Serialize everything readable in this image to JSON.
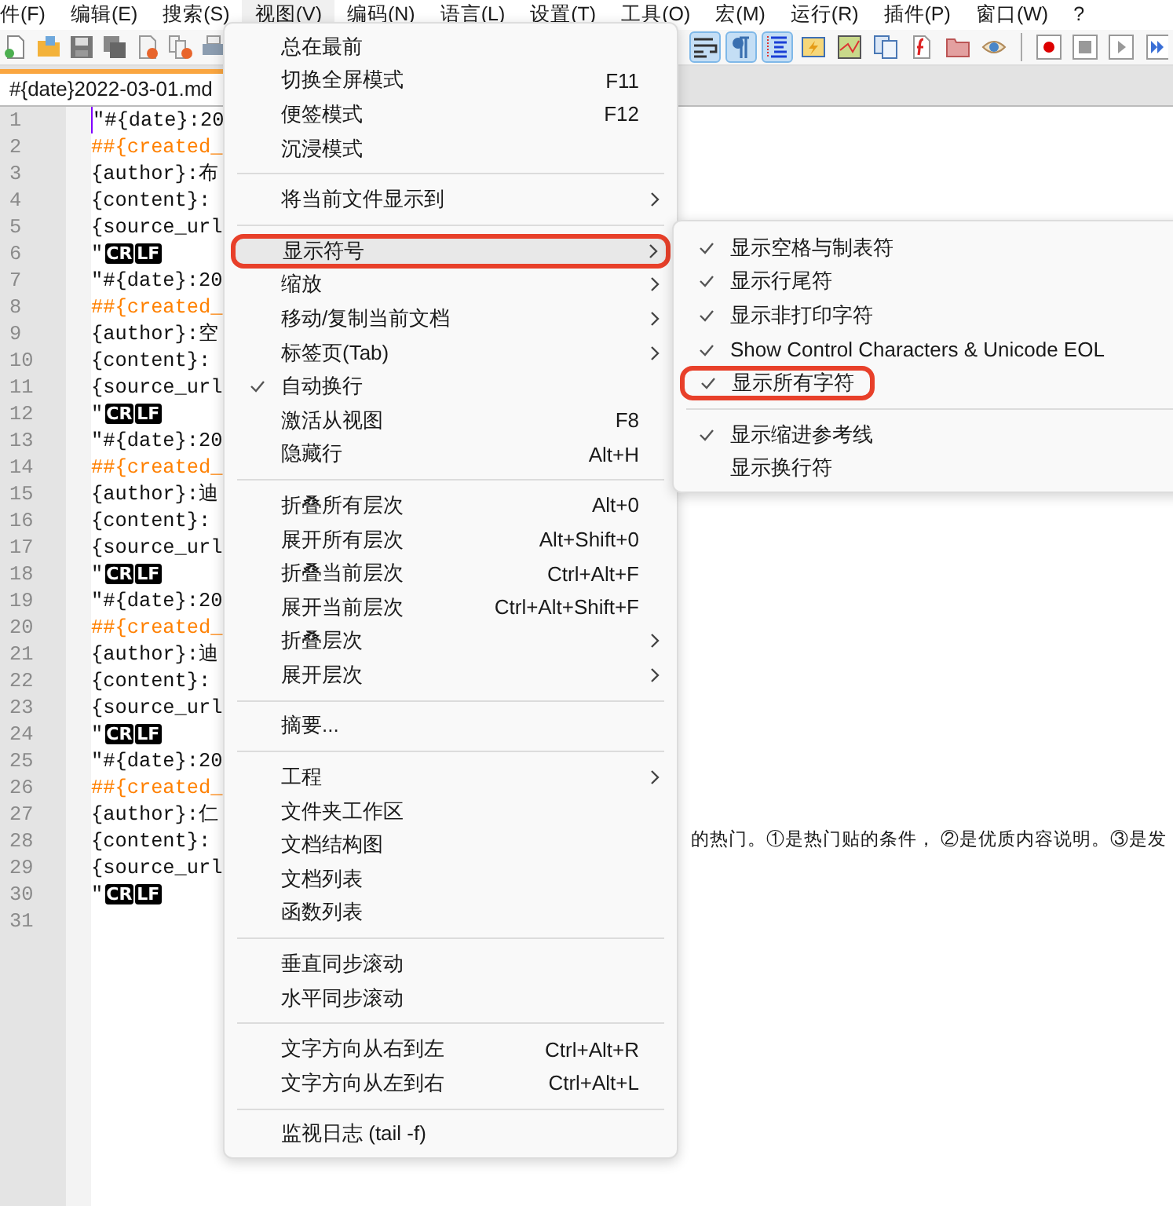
{
  "menubar": [
    {
      "label": "件(F)",
      "selected": false
    },
    {
      "label": "编辑(E)",
      "selected": false
    },
    {
      "label": "搜索(S)",
      "selected": false
    },
    {
      "label": "视图(V)",
      "selected": true
    },
    {
      "label": "编码(N)",
      "selected": false
    },
    {
      "label": "语言(L)",
      "selected": false
    },
    {
      "label": "设置(T)",
      "selected": false
    },
    {
      "label": "工具(O)",
      "selected": false
    },
    {
      "label": "宏(M)",
      "selected": false
    },
    {
      "label": "运行(R)",
      "selected": false
    },
    {
      "label": "插件(P)",
      "selected": false
    },
    {
      "label": "窗口(W)",
      "selected": false
    },
    {
      "label": "?",
      "selected": false
    }
  ],
  "toolbar_left": [
    {
      "kind": "new",
      "on": false
    },
    {
      "kind": "open",
      "on": false
    },
    {
      "kind": "save",
      "on": false
    },
    {
      "kind": "save-all",
      "on": false
    },
    {
      "kind": "close",
      "on": false
    },
    {
      "kind": "close-all",
      "on": false
    },
    {
      "kind": "print",
      "on": false
    }
  ],
  "toolbar_right": [
    {
      "kind": "wrap",
      "on": true
    },
    {
      "kind": "pilcrow",
      "on": true
    },
    {
      "kind": "indent-guide",
      "on": true
    },
    {
      "kind": "lightning",
      "on": false
    },
    {
      "kind": "map",
      "on": false
    },
    {
      "kind": "documents",
      "on": false
    },
    {
      "kind": "function",
      "on": false
    },
    {
      "kind": "folder",
      "on": false
    },
    {
      "kind": "eye",
      "on": false
    },
    {
      "kind": "separator"
    },
    {
      "kind": "record",
      "on": false
    },
    {
      "kind": "stop",
      "on": false
    },
    {
      "kind": "play",
      "on": false
    },
    {
      "kind": "fast-forward",
      "on": false
    }
  ],
  "tab": {
    "label": "#{date}2022-03-01.md"
  },
  "lines": [
    {
      "number": "1",
      "kind": "text",
      "text": "\"#{date}:20"
    },
    {
      "number": "2",
      "kind": "heading",
      "text": "##{created_"
    },
    {
      "number": "3",
      "kind": "text",
      "text": "{author}:布"
    },
    {
      "number": "4",
      "kind": "text",
      "text": "{content}:"
    },
    {
      "number": "5",
      "kind": "text",
      "text": "{source_url"
    },
    {
      "number": "6",
      "kind": "eol",
      "text": "\"",
      "cr": "CR",
      "lf": "LF"
    },
    {
      "number": "7",
      "kind": "text",
      "text": "\"#{date}:20"
    },
    {
      "number": "8",
      "kind": "heading",
      "text": "##{created_"
    },
    {
      "number": "9",
      "kind": "text",
      "text": "{author}:空"
    },
    {
      "number": "10",
      "kind": "text",
      "text": "{content}:"
    },
    {
      "number": "11",
      "kind": "text",
      "text": "{source_url"
    },
    {
      "number": "12",
      "kind": "eol",
      "text": "\"",
      "cr": "CR",
      "lf": "LF"
    },
    {
      "number": "13",
      "kind": "text",
      "text": "\"#{date}:20"
    },
    {
      "number": "14",
      "kind": "heading",
      "text": "##{created_"
    },
    {
      "number": "15",
      "kind": "text",
      "text": "{author}:迪"
    },
    {
      "number": "16",
      "kind": "text",
      "text": "{content}:"
    },
    {
      "number": "17",
      "kind": "text",
      "text": "{source_url"
    },
    {
      "number": "18",
      "kind": "eol",
      "text": "\"",
      "cr": "CR",
      "lf": "LF"
    },
    {
      "number": "19",
      "kind": "text",
      "text": "\"#{date}:20"
    },
    {
      "number": "20",
      "kind": "heading",
      "text": "##{created_"
    },
    {
      "number": "21",
      "kind": "text",
      "text": "{author}:迪"
    },
    {
      "number": "22",
      "kind": "text",
      "text": "{content}:"
    },
    {
      "number": "23",
      "kind": "text",
      "text": "{source_url"
    },
    {
      "number": "24",
      "kind": "eol",
      "text": "\"",
      "cr": "CR",
      "lf": "LF"
    },
    {
      "number": "25",
      "kind": "text",
      "text": "\"#{date}:20"
    },
    {
      "number": "26",
      "kind": "heading",
      "text": "##{created_"
    },
    {
      "number": "27",
      "kind": "text",
      "text": "{author}:仁"
    },
    {
      "number": "28",
      "kind": "text",
      "text": "{content}:",
      "tail": "的热门。①是热门贴的条件， ②是优质内容说明。③是发"
    },
    {
      "number": "29",
      "kind": "text",
      "text": "{source_url"
    },
    {
      "number": "30",
      "kind": "eol",
      "text": "\"",
      "cr": "CR",
      "lf": "LF"
    },
    {
      "number": "31",
      "kind": "empty"
    }
  ],
  "view_menu": [
    {
      "kind": "item",
      "label": "总在最前",
      "checked": false,
      "selected": false,
      "submenu": false,
      "highlighted": false
    },
    {
      "kind": "item",
      "label": "切换全屏模式",
      "shortcut": "F11",
      "checked": false,
      "selected": false,
      "submenu": false,
      "highlighted": false
    },
    {
      "kind": "item",
      "label": "便签模式",
      "shortcut": "F12",
      "checked": false,
      "selected": false,
      "submenu": false,
      "highlighted": false
    },
    {
      "kind": "item",
      "label": "沉浸模式",
      "checked": false,
      "selected": false,
      "submenu": false,
      "highlighted": false
    },
    {
      "kind": "separator"
    },
    {
      "kind": "item",
      "label": "将当前文件显示到",
      "checked": false,
      "selected": false,
      "submenu": true,
      "highlighted": false
    },
    {
      "kind": "separator"
    },
    {
      "kind": "item",
      "label": "显示符号",
      "checked": false,
      "selected": true,
      "submenu": true,
      "highlighted": true
    },
    {
      "kind": "item",
      "label": "缩放",
      "checked": false,
      "selected": false,
      "submenu": true,
      "highlighted": false
    },
    {
      "kind": "item",
      "label": "移动/复制当前文档",
      "checked": false,
      "selected": false,
      "submenu": true,
      "highlighted": false
    },
    {
      "kind": "item",
      "label": "标签页(Tab)",
      "checked": false,
      "selected": false,
      "submenu": true,
      "highlighted": false
    },
    {
      "kind": "item",
      "label": "自动换行",
      "checked": true,
      "selected": false,
      "submenu": false,
      "highlighted": false
    },
    {
      "kind": "item",
      "label": "激活从视图",
      "shortcut": "F8",
      "checked": false,
      "selected": false,
      "submenu": false,
      "highlighted": false
    },
    {
      "kind": "item",
      "label": "隐藏行",
      "shortcut": "Alt+H",
      "checked": false,
      "selected": false,
      "submenu": false,
      "highlighted": false
    },
    {
      "kind": "separator"
    },
    {
      "kind": "item",
      "label": "折叠所有层次",
      "shortcut": "Alt+0",
      "checked": false,
      "selected": false,
      "submenu": false,
      "highlighted": false
    },
    {
      "kind": "item",
      "label": "展开所有层次",
      "shortcut": "Alt+Shift+0",
      "checked": false,
      "selected": false,
      "submenu": false,
      "highlighted": false
    },
    {
      "kind": "item",
      "label": "折叠当前层次",
      "shortcut": "Ctrl+Alt+F",
      "checked": false,
      "selected": false,
      "submenu": false,
      "highlighted": false
    },
    {
      "kind": "item",
      "label": "展开当前层次",
      "shortcut": "Ctrl+Alt+Shift+F",
      "checked": false,
      "selected": false,
      "submenu": false,
      "highlighted": false
    },
    {
      "kind": "item",
      "label": "折叠层次",
      "checked": false,
      "selected": false,
      "submenu": true,
      "highlighted": false
    },
    {
      "kind": "item",
      "label": "展开层次",
      "checked": false,
      "selected": false,
      "submenu": true,
      "highlighted": false
    },
    {
      "kind": "separator"
    },
    {
      "kind": "item",
      "label": "摘要...",
      "checked": false,
      "selected": false,
      "submenu": false,
      "highlighted": false
    },
    {
      "kind": "separator"
    },
    {
      "kind": "item",
      "label": "工程",
      "checked": false,
      "selected": false,
      "submenu": true,
      "highlighted": false
    },
    {
      "kind": "item",
      "label": "文件夹工作区",
      "checked": false,
      "selected": false,
      "submenu": false,
      "highlighted": false
    },
    {
      "kind": "item",
      "label": "文档结构图",
      "checked": false,
      "selected": false,
      "submenu": false,
      "highlighted": false
    },
    {
      "kind": "item",
      "label": "文档列表",
      "checked": false,
      "selected": false,
      "submenu": false,
      "highlighted": false
    },
    {
      "kind": "item",
      "label": "函数列表",
      "checked": false,
      "selected": false,
      "submenu": false,
      "highlighted": false
    },
    {
      "kind": "separator"
    },
    {
      "kind": "item",
      "label": "垂直同步滚动",
      "checked": false,
      "selected": false,
      "submenu": false,
      "highlighted": false
    },
    {
      "kind": "item",
      "label": "水平同步滚动",
      "checked": false,
      "selected": false,
      "submenu": false,
      "highlighted": false
    },
    {
      "kind": "separator"
    },
    {
      "kind": "item",
      "label": "文字方向从右到左",
      "shortcut": "Ctrl+Alt+R",
      "checked": false,
      "selected": false,
      "submenu": false,
      "highlighted": false
    },
    {
      "kind": "item",
      "label": "文字方向从左到右",
      "shortcut": "Ctrl+Alt+L",
      "checked": false,
      "selected": false,
      "submenu": false,
      "highlighted": false
    },
    {
      "kind": "separator"
    },
    {
      "kind": "item",
      "label": "监视日志 (tail -f)",
      "checked": false,
      "selected": false,
      "submenu": false,
      "highlighted": false
    }
  ],
  "symbols_submenu": [
    {
      "kind": "item",
      "label": "显示空格与制表符",
      "checked": true,
      "highlighted": false
    },
    {
      "kind": "item",
      "label": "显示行尾符",
      "checked": true,
      "highlighted": false
    },
    {
      "kind": "item",
      "label": "显示非打印字符",
      "checked": true,
      "highlighted": false
    },
    {
      "kind": "item",
      "label": "Show Control Characters & Unicode EOL",
      "checked": true,
      "highlighted": false
    },
    {
      "kind": "item",
      "label": "显示所有字符",
      "checked": true,
      "highlighted": true
    },
    {
      "kind": "separator"
    },
    {
      "kind": "item",
      "label": "显示缩进参考线",
      "checked": true,
      "highlighted": false
    },
    {
      "kind": "item",
      "label": "显示换行符",
      "checked": false,
      "highlighted": false
    }
  ]
}
